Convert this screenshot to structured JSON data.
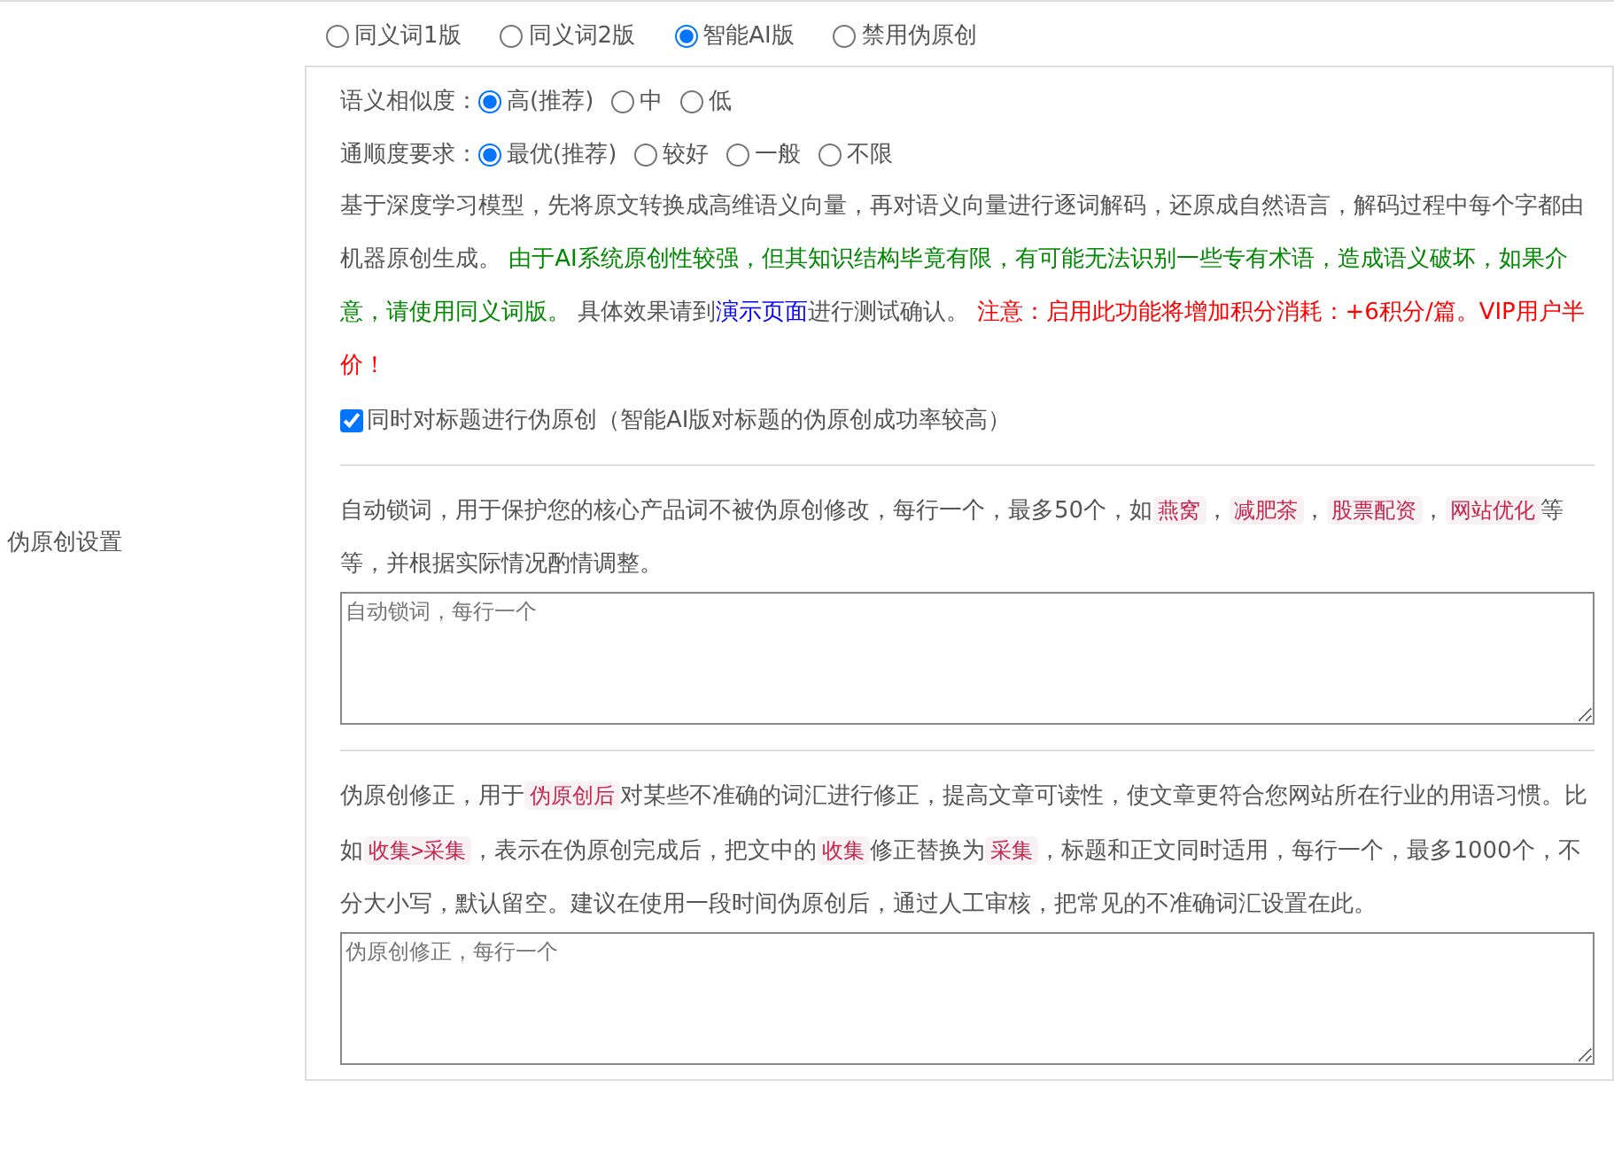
{
  "label": "伪原创设置",
  "modes": [
    {
      "label": "同义词1版",
      "selected": false
    },
    {
      "label": "同义词2版",
      "selected": false
    },
    {
      "label": "智能AI版",
      "selected": true
    },
    {
      "label": "禁用伪原创",
      "selected": false
    }
  ],
  "settings": [
    {
      "label": "语义相似度：",
      "options": [
        {
          "label": "高(推荐)",
          "selected": true
        },
        {
          "label": "中",
          "selected": false
        },
        {
          "label": "低",
          "selected": false
        }
      ]
    },
    {
      "label": "通顺度要求：",
      "options": [
        {
          "label": "最优(推荐)",
          "selected": true
        },
        {
          "label": "较好",
          "selected": false
        },
        {
          "label": "一般",
          "selected": false
        },
        {
          "label": "不限",
          "selected": false
        }
      ]
    }
  ],
  "description": [
    {
      "kind": "text",
      "text": "基于深度学习模型，先将原文转换成高维语义向量，再对语义向量进行逐词解码，还原成自然语言，解码过程中每个字都由机器原创生成。 "
    },
    {
      "kind": "green",
      "text": "由于AI系统原创性较强，但其知识结构毕竟有限，有可能无法识别一些专有术语，造成语义破坏，如果介意，请使用同义词版。"
    },
    {
      "kind": "text",
      "text": " 具体效果请到"
    },
    {
      "kind": "link",
      "text": "演示页面"
    },
    {
      "kind": "text",
      "text": "进行测试确认。 "
    },
    {
      "kind": "red",
      "text": "注意：启用此功能将增加积分消耗：+6积分/篇。VIP用户半价！"
    }
  ],
  "title_option": {
    "label": "同时对标题进行伪原创（智能AI版对标题的伪原创成功率较高）",
    "checked": true
  },
  "sections": [
    {
      "description": [
        {
          "kind": "text",
          "text": "自动锁词，用于保护您的核心产品词不被伪原创修改，每行一个，最多50个，如"
        },
        {
          "kind": "code",
          "text": "燕窝"
        },
        {
          "kind": "text",
          "text": "，"
        },
        {
          "kind": "code",
          "text": "减肥茶"
        },
        {
          "kind": "text",
          "text": "，"
        },
        {
          "kind": "code",
          "text": "股票配资"
        },
        {
          "kind": "text",
          "text": "，"
        },
        {
          "kind": "code",
          "text": "网站优化"
        },
        {
          "kind": "text",
          "text": "等等，并根据实际情况酌情调整。"
        }
      ],
      "placeholder": "自动锁词，每行一个"
    },
    {
      "description": [
        {
          "kind": "text",
          "text": "伪原创修正，用于"
        },
        {
          "kind": "code",
          "text": "伪原创后"
        },
        {
          "kind": "text",
          "text": "对某些不准确的词汇进行修正，提高文章可读性，使文章更符合您网站所在行业的用语习惯。比如"
        },
        {
          "kind": "code",
          "text": "收集>采集"
        },
        {
          "kind": "text",
          "text": "，表示在伪原创完成后，把文中的"
        },
        {
          "kind": "code",
          "text": "收集"
        },
        {
          "kind": "text",
          "text": "修正替换为"
        },
        {
          "kind": "code",
          "text": "采集"
        },
        {
          "kind": "text",
          "text": "，标题和正文同时适用，每行一个，最多1000个，不分大小写，默认留空。建议在使用一段时间伪原创后，通过人工审核，把常见的不准确词汇设置在此。"
        }
      ],
      "placeholder": "伪原创修正，每行一个"
    }
  ]
}
